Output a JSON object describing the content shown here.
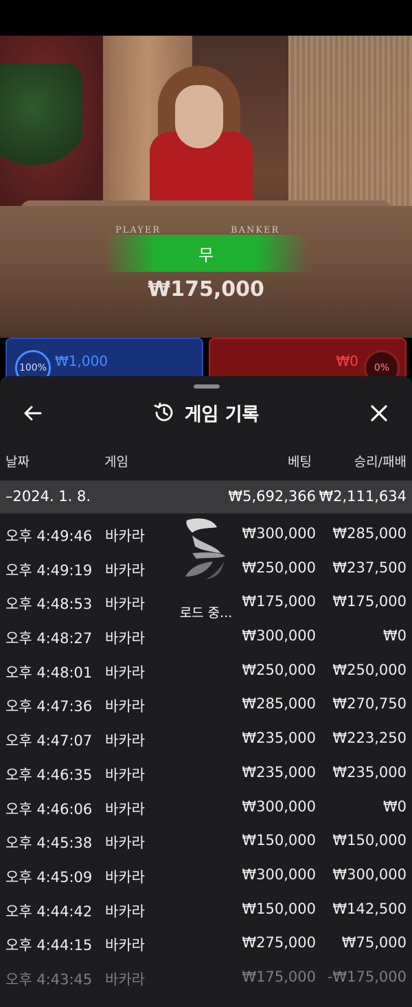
{
  "video": {
    "table_label_player": "PLAYER",
    "table_label_banker": "BANKER",
    "result_text": "무",
    "win_amount": "₩175,000"
  },
  "bet_panels": {
    "player": {
      "percent": "100%",
      "amount": "₩1,000"
    },
    "banker": {
      "percent": "0%",
      "amount": "₩0"
    }
  },
  "sheet": {
    "title": "게임 기록",
    "icons": {
      "back": "arrow-left-icon",
      "history": "history-clock-icon",
      "close": "close-icon"
    },
    "columns": {
      "date": "날짜",
      "game": "게임",
      "bet": "베팅",
      "result": "승리/패배"
    },
    "summary": {
      "date": "–2024. 1. 8.",
      "bet": "₩5,692,366",
      "result": "₩2,111,634"
    },
    "rows": [
      {
        "time": "오후 4:49:46",
        "game": "바카라",
        "bet": "₩300,000",
        "result": "₩285,000"
      },
      {
        "time": "오후 4:49:19",
        "game": "바카라",
        "bet": "₩250,000",
        "result": "₩237,500"
      },
      {
        "time": "오후 4:48:53",
        "game": "바카라",
        "bet": "₩175,000",
        "result": "₩175,000"
      },
      {
        "time": "오후 4:48:27",
        "game": "바카라",
        "bet": "₩300,000",
        "result": "₩0"
      },
      {
        "time": "오후 4:48:01",
        "game": "바카라",
        "bet": "₩250,000",
        "result": "₩250,000"
      },
      {
        "time": "오후 4:47:36",
        "game": "바카라",
        "bet": "₩285,000",
        "result": "₩270,750"
      },
      {
        "time": "오후 4:47:07",
        "game": "바카라",
        "bet": "₩235,000",
        "result": "₩223,250"
      },
      {
        "time": "오후 4:46:35",
        "game": "바카라",
        "bet": "₩235,000",
        "result": "₩235,000"
      },
      {
        "time": "오후 4:46:06",
        "game": "바카라",
        "bet": "₩300,000",
        "result": "₩0"
      },
      {
        "time": "오후 4:45:38",
        "game": "바카라",
        "bet": "₩150,000",
        "result": "₩150,000"
      },
      {
        "time": "오후 4:45:09",
        "game": "바카라",
        "bet": "₩300,000",
        "result": "₩300,000"
      },
      {
        "time": "오후 4:44:42",
        "game": "바카라",
        "bet": "₩150,000",
        "result": "₩142,500"
      },
      {
        "time": "오후 4:44:15",
        "game": "바카라",
        "bet": "₩275,000",
        "result": "₩75,000"
      },
      {
        "time": "오후 4:43:45",
        "game": "바카라",
        "bet": "₩175,000",
        "result": "-₩175,000"
      }
    ],
    "loader_text": "로드 중..."
  },
  "colors": {
    "sheet_bg": "#1d1d1f",
    "summary_bg": "#3a3a3c",
    "result_green": "#1fb02f",
    "player_blue": "#4c8cff",
    "banker_red": "#ff4040"
  }
}
